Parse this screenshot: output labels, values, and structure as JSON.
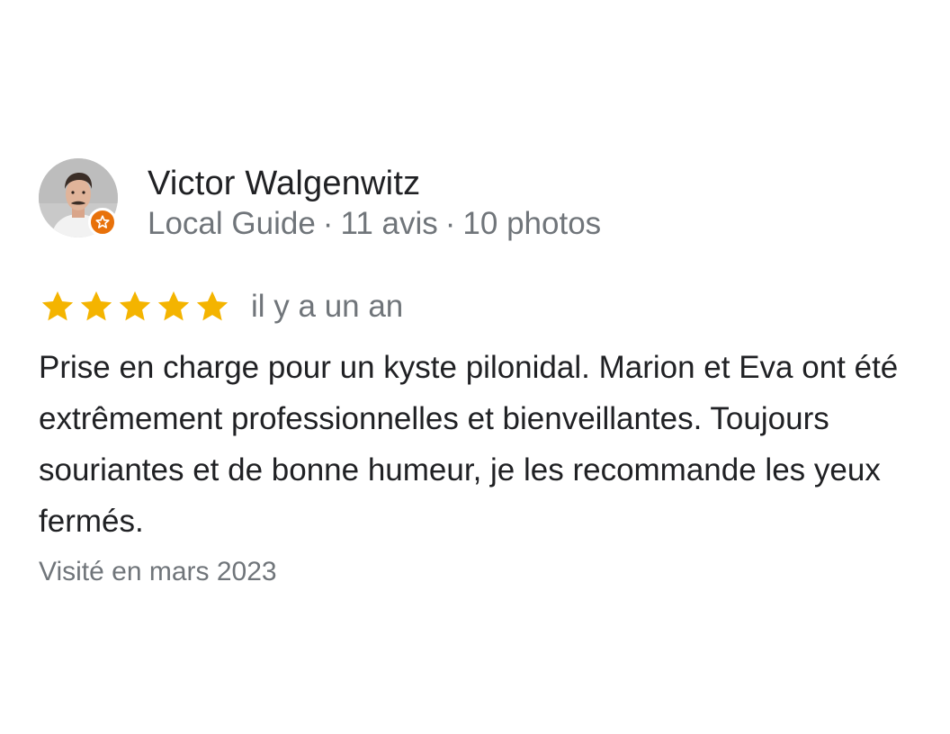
{
  "review": {
    "author": {
      "name": "Victor Walgenwitz",
      "level": "Local Guide",
      "reviews_count": "11 avis",
      "photos_count": "10 photos",
      "separator": "·",
      "avatar_icon": "profile-photo",
      "badge_icon": "local-guide-star-icon",
      "badge_color": "#e8710a"
    },
    "rating": 5,
    "rating_max": 5,
    "star_color": "#f4b400",
    "time_ago": "il y a un an",
    "text": "Prise en charge pour un kyste pilonidal. Marion et Eva ont été extrêmement professionnelles et bienveillantes. Toujours souriantes et de bonne humeur, je les recommande les yeux fermés.",
    "visited": "Visité en mars 2023"
  }
}
